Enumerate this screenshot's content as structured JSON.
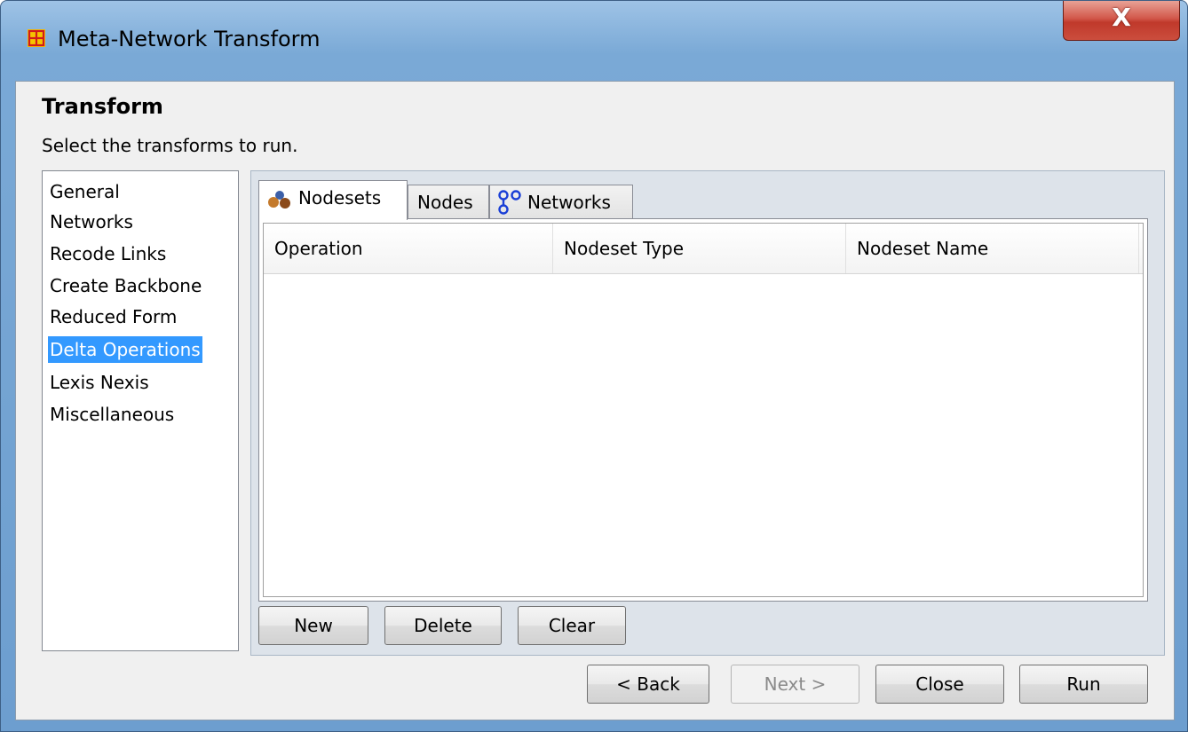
{
  "window": {
    "title": "Meta-Network Transform",
    "close_glyph": "X"
  },
  "header": {
    "title": "Transform",
    "subtitle": "Select the transforms to run."
  },
  "categories": {
    "items": [
      {
        "label": "General"
      },
      {
        "label": "Networks"
      },
      {
        "label": "Recode Links"
      },
      {
        "label": "Create Backbone"
      },
      {
        "label": "Reduced Form"
      },
      {
        "label": "Delta Operations",
        "selected": true
      },
      {
        "label": "Lexis Nexis"
      },
      {
        "label": "Miscellaneous"
      }
    ]
  },
  "tabs": [
    {
      "label": "Nodesets",
      "icon": "nodesets-icon",
      "active": true
    },
    {
      "label": "Nodes"
    },
    {
      "label": "Networks",
      "icon": "networks-icon"
    }
  ],
  "table": {
    "columns": [
      "Operation",
      "Nodeset Type",
      "Nodeset Name"
    ],
    "rows": []
  },
  "table_buttons": {
    "new": "New",
    "delete": "Delete",
    "clear": "Clear"
  },
  "footer": {
    "back": "< Back",
    "next": "Next >",
    "close": "Close",
    "run": "Run"
  },
  "colors": {
    "selection": "#3399ff",
    "titlebar": "#7aa9d6",
    "close_button": "#c0392b"
  }
}
